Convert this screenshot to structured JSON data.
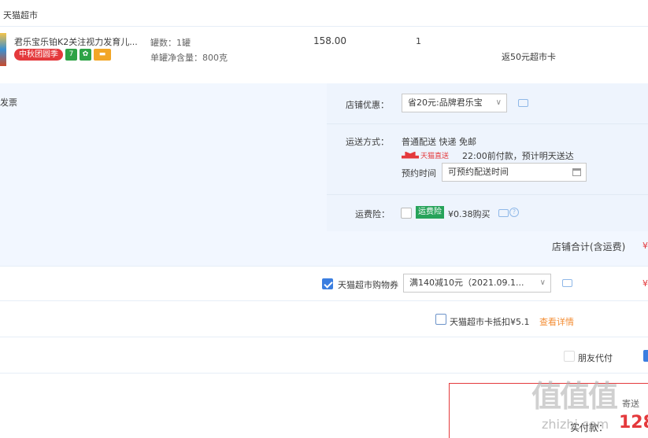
{
  "shop": {
    "name": "天猫超市"
  },
  "item": {
    "title": "君乐宝乐铂K2关注视力发育儿...",
    "tags": [
      {
        "label": "中秋团圆季",
        "color": "#e4393c"
      },
      {
        "label": "7",
        "color": "#2ea346"
      },
      {
        "label": "",
        "color": "#2ea346"
      },
      {
        "label": "",
        "color": "#f2a626"
      }
    ],
    "prop_count": "罐数：1罐",
    "prop_weight": "单罐净含量：800克",
    "price": "158.00",
    "quantity": "1",
    "rebate": "返50元超市卡"
  },
  "options": {
    "invoice_label": "发票",
    "shop_discount_label": "店铺优惠：",
    "shop_discount_value": "省20元:品牌君乐宝",
    "shipping_label": "运送方式：",
    "shipping_value": "普通配送 快递 免邮",
    "tmall_direct": "天猫直送",
    "delivery_note": "22:00前付款，预计明天送达",
    "appointment_label": "预约时间",
    "appointment_placeholder": "可预约配送时间",
    "insurance_label": "运费险：",
    "insurance_badge": "运费险",
    "insurance_price": "¥0.38购买"
  },
  "summary": {
    "label": "店铺合计(含运费)",
    "mark": "¥"
  },
  "coupon": {
    "label": "天猫超市购物券",
    "select_value": "满140减10元（2021.09.1...",
    "mark": "¥"
  },
  "card": {
    "label": "天猫超市卡抵扣¥5.1",
    "details_link": "查看详情"
  },
  "friend_pay": {
    "label": "朋友代付"
  },
  "payment": {
    "actual_label": "实付款：",
    "amount_partial": "128",
    "corner_text": "寄送"
  },
  "watermark": {
    "logo": "值值值",
    "url": "zhizhi.com"
  },
  "colors": {
    "accent": "#e4393c",
    "link": "#f38d34",
    "checkbox": "#3b7ee0",
    "panel": "#f2f7ff"
  }
}
